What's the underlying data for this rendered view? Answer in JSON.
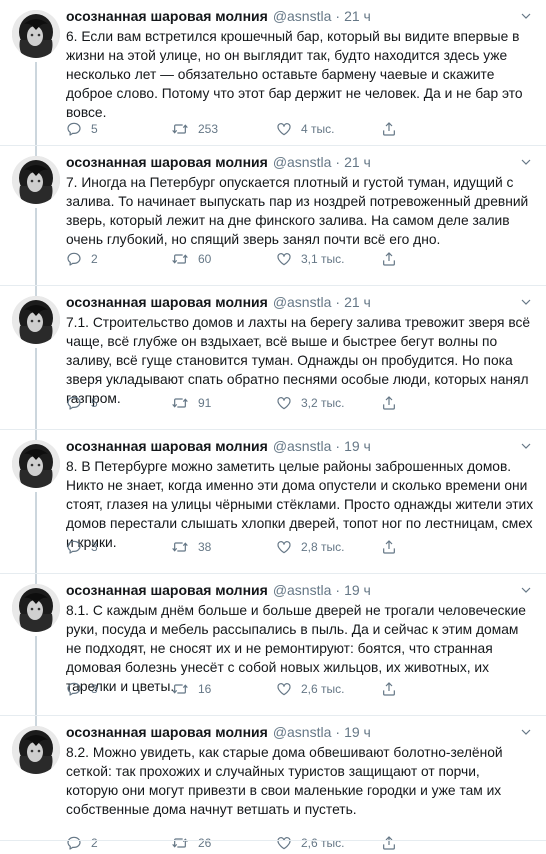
{
  "author": {
    "name": "осознанная шаровая молния",
    "handle": "@asnstla",
    "dot": "·"
  },
  "icons": {
    "reply": "reply-icon",
    "retweet": "retweet-icon",
    "like": "like-icon",
    "share": "share-icon",
    "caret": "chevron-down-icon"
  },
  "colors": {
    "icon": "#657786",
    "text": "#14171a",
    "muted": "#657786",
    "divider": "#e6ecf0"
  },
  "tweets": [
    {
      "time": "21 ч",
      "text": "6. Если вам встретился крошечный бар, который вы видите впервые в жизни на этой улице, но он выглядит так, будто находится здесь уже несколько лет — обязательно оставьте бармену чаевые и скажите доброе слово. Потому что этот бар держит не человек. Да и не бар это вовсе.",
      "replies": "5",
      "retweets": "253",
      "likes": "4 тыс."
    },
    {
      "time": "21 ч",
      "text": "7. Иногда на Петербург опускается плотный и густой туман, идущий с залива. То начинает выпускать пар из ноздрей потревоженный древний зверь, который лежит на дне финского залива. На самом деле залив очень глубокий, но спящий зверь занял почти всё его дно.",
      "replies": "2",
      "retweets": "60",
      "likes": "3,1 тыс."
    },
    {
      "time": "21 ч",
      "text": "7.1. Строительство домов и лахты на берегу залива тревожит зверя всё чаще, всё глубже он вздыхает, всё выше и быстрее бегут волны по заливу, всё гуще становится туман. Однажды он пробудится. Но пока зверя укладывают спать обратно песнями особые люди, которых нанял газпром.",
      "replies": "5",
      "retweets": "91",
      "likes": "3,2 тыс."
    },
    {
      "time": "19 ч",
      "text": "8. В Петербурге можно заметить целые районы заброшенных домов. Никто не знает, когда именно эти дома опустели и сколько времени они стоят, глазея на улицы чёрными стёклами. Просто однажды жители этих домов перестали слышать хлопки дверей, топот ног по лестницам, смех и крики.",
      "replies": "3",
      "retweets": "38",
      "likes": "2,8 тыс."
    },
    {
      "time": "19 ч",
      "text": "8.1. С каждым днём больше и больше дверей не трогали человеческие руки, посуда и мебель рассыпались в пыль. Да и сейчас к этим домам не подходят, не сносят их и не ремонтируют: боятся, что странная домовая болезнь унесёт с собой новых жильцов, их животных, их тарелки и цветы.",
      "replies": "3",
      "retweets": "16",
      "likes": "2,6 тыс."
    },
    {
      "time": "19 ч",
      "text": "8.2. Можно увидеть, как старые дома обвешивают болотно-зелёной сеткой: так прохожих и случайных туристов защищают от порчи, которую они могут привезти в свои маленькие городки и уже там их собственные дома начнут ветшать и пустеть.",
      "replies": "2",
      "retweets": "26",
      "likes": "2,6 тыс."
    }
  ]
}
